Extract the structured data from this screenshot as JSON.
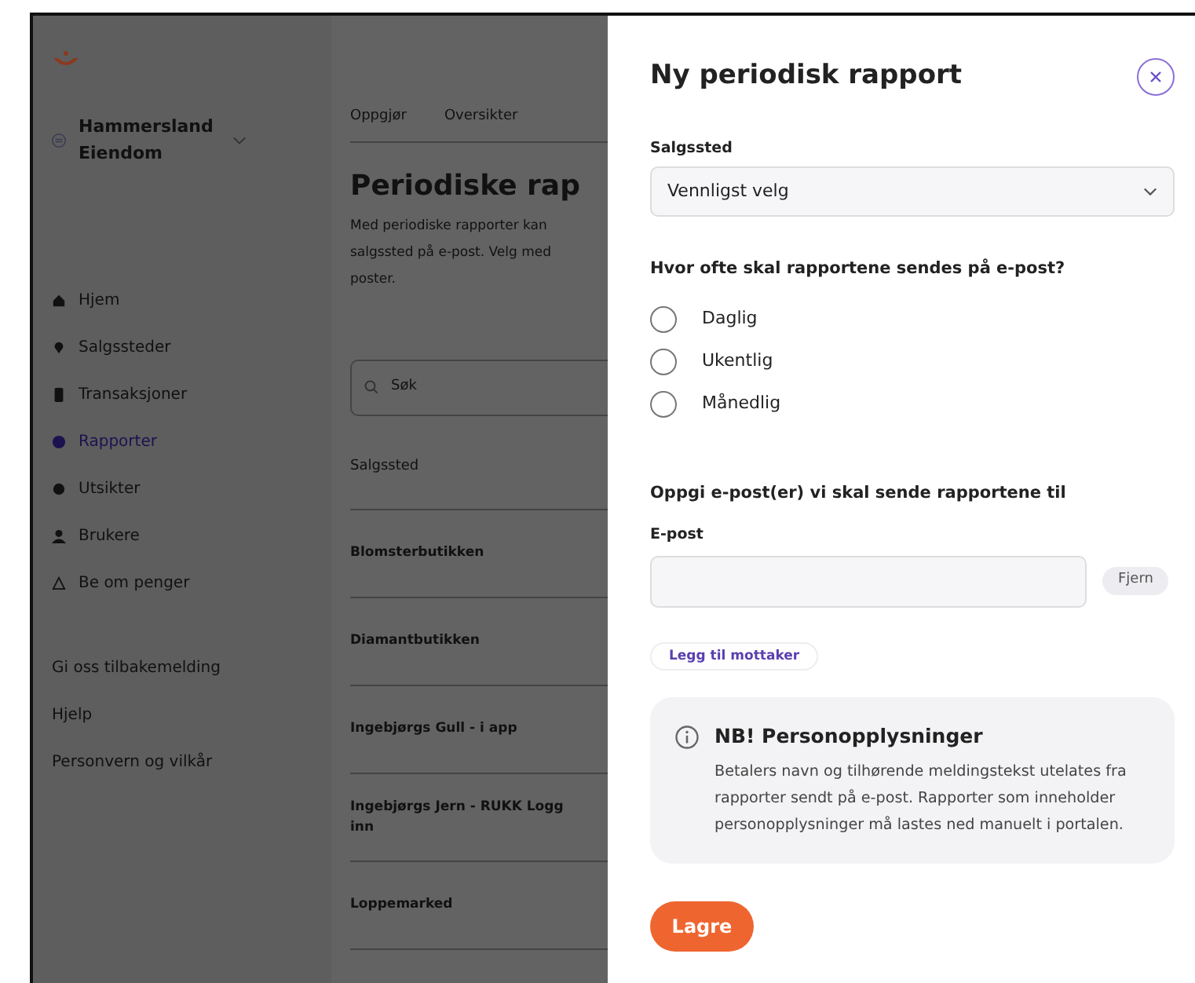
{
  "sidebar": {
    "account": "Hammersland Eiendom",
    "items": [
      {
        "label": "Hjem",
        "selected": false
      },
      {
        "label": "Salgssteder",
        "selected": false
      },
      {
        "label": "Transaksjoner",
        "selected": false
      },
      {
        "label": "Rapporter",
        "selected": true
      },
      {
        "label": "Utsikter",
        "selected": false
      },
      {
        "label": "Brukere",
        "selected": false
      },
      {
        "label": "Be om penger",
        "selected": false
      }
    ],
    "links": [
      "Gi oss tilbakemelding",
      "Hjelp",
      "Personvern og vilkår"
    ]
  },
  "main": {
    "tabs": [
      "Oppgjør",
      "Oversikter"
    ],
    "heading": "Periodiske rap",
    "intro": [
      "Med periodiske rapporter kan",
      "salgssted på e-post. Velg med",
      "poster."
    ],
    "search": {
      "placeholder": "Søk"
    },
    "column": "Salgssted",
    "rows": [
      "Blomsterbutikken",
      "Diamantbutikken",
      "Ingebjørgs Gull - i app",
      "Ingebjørgs Jern - RUKK Logg inn",
      "Loppemarked"
    ]
  },
  "dialog": {
    "title": "Ny periodisk rapport",
    "select_label": "Salgssted",
    "select_value": "Vennligst velg",
    "frequency_question": "Hvor ofte skal rapportene sendes på e-post?",
    "frequencies": [
      {
        "label": "Daglig",
        "selected": false
      },
      {
        "label": "Ukentlig",
        "selected": false
      },
      {
        "label": "Månedlig",
        "selected": false
      }
    ],
    "recipients_heading": "Oppgi e-post(er) vi skal sende rapportene til",
    "email_label": "E-post",
    "remove_button": "Fjern",
    "add_button": "Legg til mottaker",
    "notice": {
      "title": "NB! Personopplysninger",
      "text": "Betalers navn og tilhørende meldingstekst utelates fra rapporter sendt på e-post. Rapporter som inneholder personopplysninger må lastes ned manuelt i portalen."
    },
    "save_button": "Lagre"
  }
}
